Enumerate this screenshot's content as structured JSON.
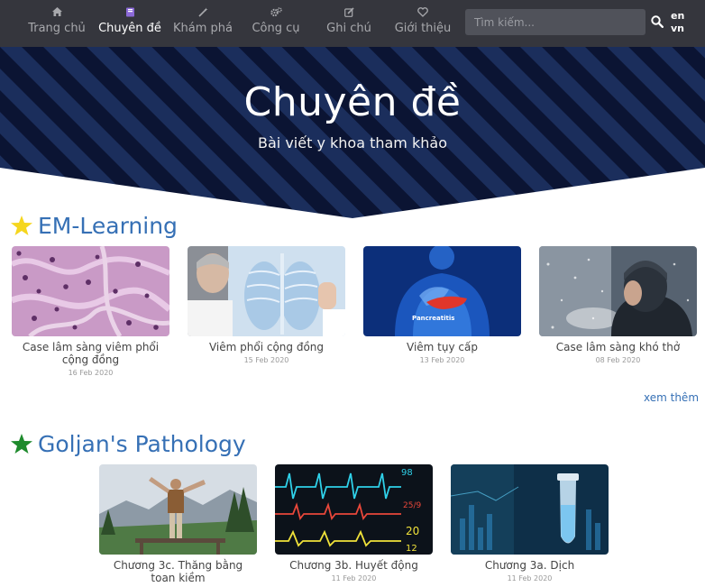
{
  "nav": {
    "items": [
      {
        "label": "Trang chủ",
        "icon": "home-icon"
      },
      {
        "label": "Chuyên đề",
        "icon": "book-icon"
      },
      {
        "label": "Khám phá",
        "icon": "magic-wand-icon"
      },
      {
        "label": "Công cụ",
        "icon": "gears-icon"
      },
      {
        "label": "Ghi chú",
        "icon": "edit-icon"
      },
      {
        "label": "Giới thiệu",
        "icon": "heart-icon"
      }
    ],
    "search_placeholder": "Tìm kiếm...",
    "lang_en": "en",
    "lang_vn": "vn"
  },
  "hero": {
    "title": "Chuyên đề",
    "subtitle": "Bài viết y khoa tham khảo"
  },
  "sections": [
    {
      "title": "EM-Learning",
      "star_color": "#f5d61e",
      "more_label": "xem thêm",
      "cards": [
        {
          "title": "Case lâm sàng viêm phổi cộng đồng",
          "date": "16 Feb 2020"
        },
        {
          "title": "Viêm phổi cộng đồng",
          "date": "15 Feb 2020"
        },
        {
          "title": "Viêm tụy cấp",
          "date": "13 Feb 2020",
          "img_caption": "Pancreatitis"
        },
        {
          "title": "Case lâm sàng khó thở",
          "date": "08 Feb 2020"
        }
      ]
    },
    {
      "title": "Goljan's Pathology",
      "star_color": "#1e8a2c",
      "cards": [
        {
          "title": "Chương 3c. Thăng bằng toan kiềm",
          "date": ""
        },
        {
          "title": "Chương 3b. Huyết động",
          "date": "11 Feb 2020",
          "img_numbers": [
            "98",
            "25/9",
            "20",
            "12"
          ]
        },
        {
          "title": "Chương 3a. Dịch",
          "date": "11 Feb 2020"
        }
      ]
    }
  ],
  "colors": {
    "nav_bg": "#35363d",
    "hero_bg": "#0b1433",
    "accent": "#3670b5"
  }
}
